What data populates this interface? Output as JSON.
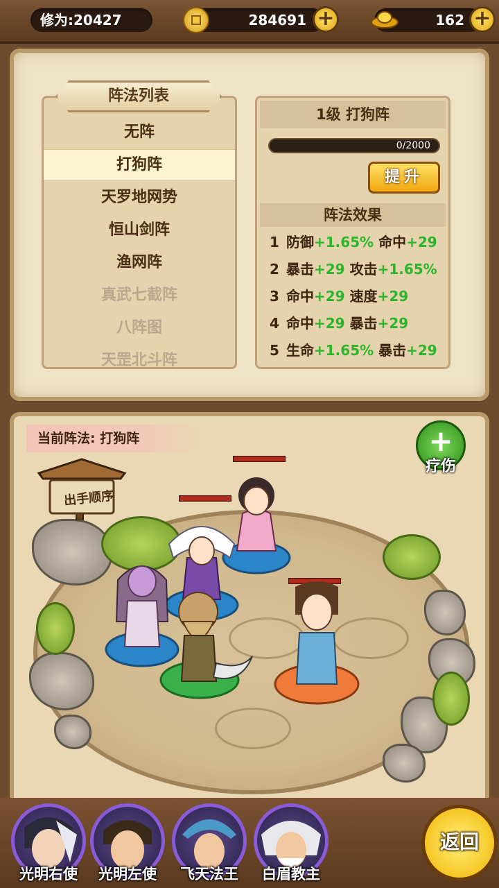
{
  "topbar": {
    "cultivation": "修为:20427",
    "coins": "284691",
    "ingots": "162"
  },
  "formation_list": {
    "title": "阵法列表",
    "items": [
      "无阵",
      "打狗阵",
      "天罗地网势",
      "恒山剑阵",
      "渔网阵",
      "真武七截阵",
      "八阵图",
      "天罡北斗阵"
    ],
    "selected_index": 1
  },
  "formation_info": {
    "header": "1级 打狗阵",
    "progress_text": "0/2000",
    "progress_fraction": 0,
    "upgrade_label": "提升",
    "effects_title": "阵法效果",
    "effects": [
      {
        "n": "1",
        "a": "防御",
        "av": "+1.65%",
        "b": "命中",
        "bv": "+29"
      },
      {
        "n": "2",
        "a": "暴击",
        "av": "+29",
        "b": "攻击",
        "bv": "+1.65%"
      },
      {
        "n": "3",
        "a": "命中",
        "av": "+29",
        "b": "速度",
        "bv": "+29"
      },
      {
        "n": "4",
        "a": "命中",
        "av": "+29",
        "b": "暴击",
        "bv": "+29"
      },
      {
        "n": "5",
        "a": "生命",
        "av": "+1.65%",
        "b": "暴击",
        "bv": "+29"
      }
    ]
  },
  "battlefield": {
    "current_label": "当前阵法: 打狗阵",
    "sign_text": "出手顺序",
    "heal_label": "疗伤"
  },
  "team": [
    {
      "name": "光明右使"
    },
    {
      "name": "光明左使"
    },
    {
      "name": "飞天法王"
    },
    {
      "name": "白眉教主"
    }
  ],
  "back_label": "返回",
  "colors": {
    "accent_green": "#2bb52b",
    "gold": "#f0a810",
    "parchment": "#efe3c6"
  }
}
